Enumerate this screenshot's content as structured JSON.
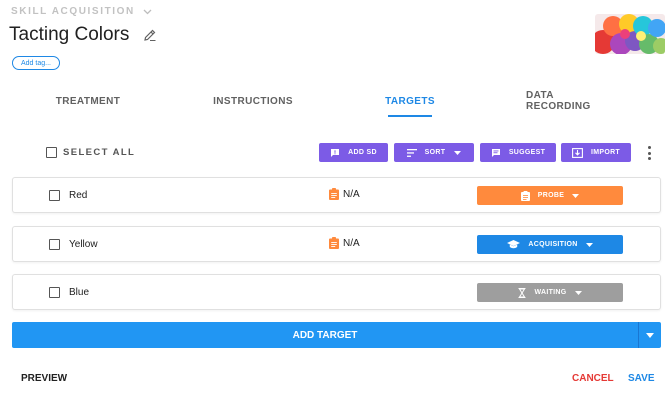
{
  "header": {
    "category": "SKILL ACQUISITION",
    "title": "Tacting Colors",
    "add_tag": "Add tag..."
  },
  "tabs": [
    {
      "label": "TREATMENT",
      "active": false
    },
    {
      "label": "INSTRUCTIONS",
      "active": false
    },
    {
      "label": "TARGETS",
      "active": true
    },
    {
      "label": "DATA RECORDING",
      "active": false
    }
  ],
  "toolbar": {
    "select_all": "SELECT ALL",
    "add_sd": "ADD SD",
    "sort": "SORT",
    "suggest": "SUGGEST",
    "import": "IMPORT"
  },
  "targets": [
    {
      "name": "Red",
      "note": "N/A",
      "status": "PROBE",
      "status_color": "#ff8a3d"
    },
    {
      "name": "Yellow",
      "note": "N/A",
      "status": "ACQUISITION",
      "status_color": "#1e88e5"
    },
    {
      "name": "Blue",
      "note": "",
      "status": "WAITING",
      "status_color": "#9e9e9e"
    }
  ],
  "actions": {
    "add_target": "ADD TARGET",
    "preview": "PREVIEW",
    "cancel": "CANCEL",
    "save": "SAVE"
  },
  "colors": {
    "primary": "#2196f3",
    "toolbar_button": "#7c5be6",
    "cancel": "#e53935"
  }
}
